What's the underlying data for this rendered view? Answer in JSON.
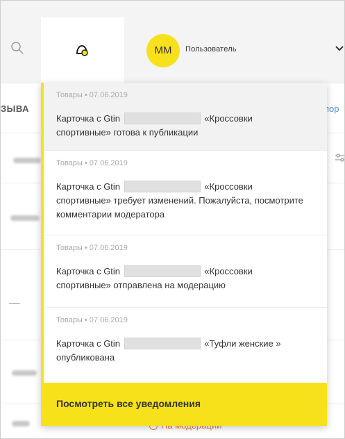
{
  "header": {
    "avatar_initials": "ММ",
    "user_name": "Пользователь"
  },
  "table": {
    "column_header_left": "ЗЫВА",
    "column_header_right": "пор",
    "status_text": "На модерации"
  },
  "notifications": {
    "items": [
      {
        "meta": "Товары • 07.06.2019",
        "prefix": "Карточка с Gtin",
        "suffix": "«Кроссовки спортивные» готова к публикации"
      },
      {
        "meta": "Товары • 07.06.2019",
        "prefix": "Карточка с Gtin",
        "suffix": "«Кроссовки спортивные» требует изменений. Пожалуйста, посмотрите комментарии модератора"
      },
      {
        "meta": "Товары • 07.06.2019",
        "prefix": "Карточка с Gtin",
        "suffix": "«Кроссовки спортивные» отправлена на модерацию"
      },
      {
        "meta": "Товары • 07.06.2019",
        "prefix": "Карточка с Gtin",
        "suffix": "«Туфли женские » опубликована"
      }
    ],
    "view_all_label": "Посмотреть все уведомления"
  },
  "colors": {
    "accent_yellow": "#f7e11b",
    "status_orange": "#e87f3f"
  },
  "icons": [
    "search-icon",
    "bell-icon",
    "chevron-down-icon",
    "filter-icon",
    "status-icon"
  ]
}
